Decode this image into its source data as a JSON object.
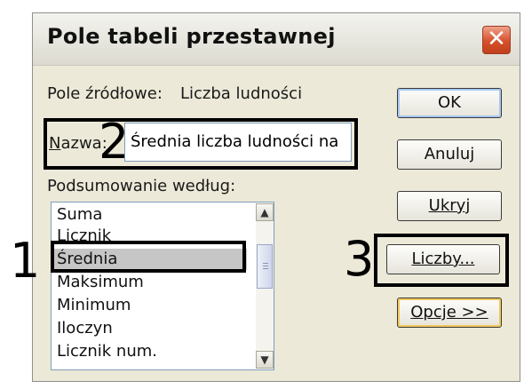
{
  "dialog": {
    "title": "Pole tabeli przestawnej",
    "close_symbol": "✕",
    "source_label": "Pole źródłowe:",
    "source_value": "Liczba ludności",
    "name_label": "Nazwa:",
    "name_label_accesskey": "N",
    "name_value": "Średnia liczba ludności na",
    "summary_label": "Podsumowanie według:",
    "summary_items": [
      "Suma",
      "Licznik",
      "Średnia",
      "Maksimum",
      "Minimum",
      "Iloczyn",
      "Licznik num."
    ],
    "selected_item": "Średnia",
    "buttons": {
      "ok": "OK",
      "cancel": "Anuluj",
      "hide": "Ukryj",
      "numbers": "Liczby...",
      "options": "Opcje >>"
    }
  },
  "annotations": {
    "one": "1",
    "two": "2",
    "three": "3"
  },
  "icons": {
    "close": "close-icon",
    "scroll_up": "scroll-up-arrow-icon",
    "scroll_down": "scroll-down-arrow-icon"
  }
}
